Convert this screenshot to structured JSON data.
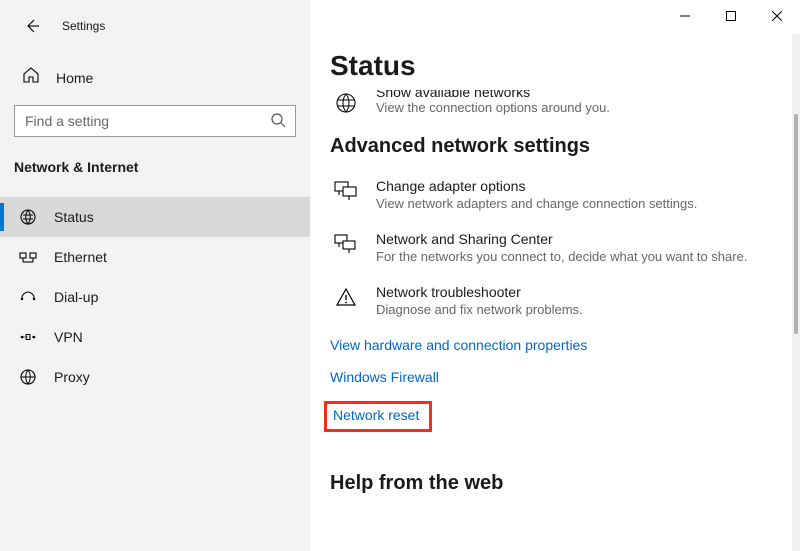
{
  "window": {
    "title": "Settings"
  },
  "sidebar": {
    "home": "Home",
    "search_placeholder": "Find a setting",
    "category": "Network & Internet",
    "items": [
      {
        "label": "Status"
      },
      {
        "label": "Ethernet"
      },
      {
        "label": "Dial-up"
      },
      {
        "label": "VPN"
      },
      {
        "label": "Proxy"
      }
    ]
  },
  "main": {
    "title": "Status",
    "available": {
      "title": "Show available networks",
      "sub": "View the connection options around you."
    },
    "advanced_heading": "Advanced network settings",
    "adapter": {
      "title": "Change adapter options",
      "sub": "View network adapters and change connection settings."
    },
    "sharing": {
      "title": "Network and Sharing Center",
      "sub": "For the networks you connect to, decide what you want to share."
    },
    "troubleshoot": {
      "title": "Network troubleshooter",
      "sub": "Diagnose and fix network problems."
    },
    "links": {
      "hardware": "View hardware and connection properties",
      "firewall": "Windows Firewall",
      "reset": "Network reset"
    },
    "help_heading": "Help from the web"
  }
}
